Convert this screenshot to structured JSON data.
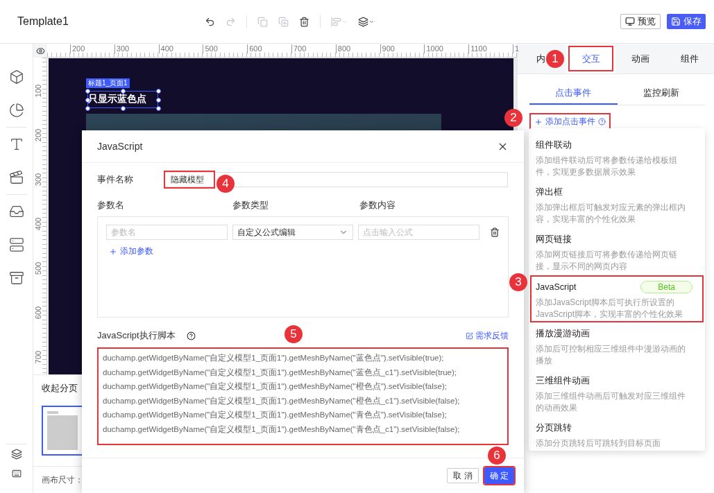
{
  "header": {
    "title": "Template1",
    "preview": "预览",
    "save": "保存"
  },
  "toolbar": [
    {
      "disabled": false
    },
    {
      "disabled": true
    },
    {
      "disabled": true
    },
    {
      "disabled": true
    },
    {
      "disabled": false
    },
    {
      "disabled": true
    },
    {
      "disabled": false
    }
  ],
  "ruler": {
    "x_labels": [
      "200",
      "300",
      "400",
      "500",
      "600",
      "700",
      "800",
      "900",
      "1000",
      "1100",
      "1"
    ],
    "y_labels": [
      "100",
      "200",
      "300",
      "400",
      "500",
      "600",
      "700"
    ]
  },
  "stage": {
    "widget_tag": "标题1_页面1",
    "widget_text": "只显示蓝色点"
  },
  "pages": {
    "toggle": "收起分页",
    "canvas_size": "画布尺寸："
  },
  "right_panel": {
    "tabs": [
      {
        "label": "内",
        "selected": false,
        "highlighted": false
      },
      {
        "label": "交互",
        "selected": true,
        "highlighted": true
      },
      {
        "label": "动画",
        "selected": false,
        "highlighted": false
      },
      {
        "label": "组件",
        "selected": false,
        "highlighted": false
      }
    ],
    "subtabs": [
      {
        "label": "点击事件",
        "selected": true
      },
      {
        "label": "监控刷新",
        "selected": false
      }
    ],
    "add_event": "添加点击事件"
  },
  "event_menu": [
    {
      "title": "组件联动",
      "description": "添加组件联动后可将参数传递给模板组件，实现更多数据展示效果",
      "highlighted": false
    },
    {
      "title": "弹出框",
      "description": "添加弹出框后可触发对应元素的弹出框内容，实现丰富的个性化效果",
      "highlighted": false
    },
    {
      "title": "网页链接",
      "description": "添加网页链接后可将参数传递给网页链接，显示不同的网页内容",
      "highlighted": false
    },
    {
      "title": "JavaScript",
      "badge": "Beta",
      "description": "添加JavaScript脚本后可执行所设置的JavaScript脚本，实现丰富的个性化效果",
      "highlighted": true
    },
    {
      "title": "播放漫游动画",
      "description": "添加后可控制相应三维组件中漫游动画的播放",
      "highlighted": false
    },
    {
      "title": "三维组件动画",
      "description": "添加三维组件动画后可触发对应三维组件的动画效果",
      "highlighted": false
    },
    {
      "title": "分页跳转",
      "description": "添加分页跳转后可跳转到目标页面",
      "highlighted": false
    }
  ],
  "dialog": {
    "title": "JavaScript",
    "event_name_label": "事件名称",
    "event_name_value": "隐藏模型",
    "param_headers": [
      "参数名",
      "参数类型",
      "参数内容"
    ],
    "param_row": {
      "name_placeholder": "参数名",
      "type_value": "自定义公式编辑",
      "content_placeholder": "点击输入公式"
    },
    "add_param": "添加参数",
    "script_label": "JavaScript执行脚本",
    "feedback": "需求反馈",
    "script_lines": [
      "duchamp.getWidgetByName(\"自定义模型1_页面1\").getMeshByName(\"蓝色点\").setVisible(true);",
      "duchamp.getWidgetByName(\"自定义模型1_页面1\").getMeshByName(\"蓝色点_c1\").setVisible(true);",
      "duchamp.getWidgetByName(\"自定义模型1_页面1\").getMeshByName(\"橙色点\").setVisible(false);",
      "duchamp.getWidgetByName(\"自定义模型1_页面1\").getMeshByName(\"橙色点_c1\").setVisible(false);",
      "duchamp.getWidgetByName(\"自定义模型1_页面1\").getMeshByName(\"青色点\").setVisible(false);",
      "duchamp.getWidgetByName(\"自定义模型1_页面1\").getMeshByName(\"青色点_c1\").setVisible(false);"
    ],
    "cancel": "取 消",
    "confirm": "确 定"
  },
  "callouts": [
    "1",
    "2",
    "3",
    "4",
    "5",
    "6"
  ]
}
